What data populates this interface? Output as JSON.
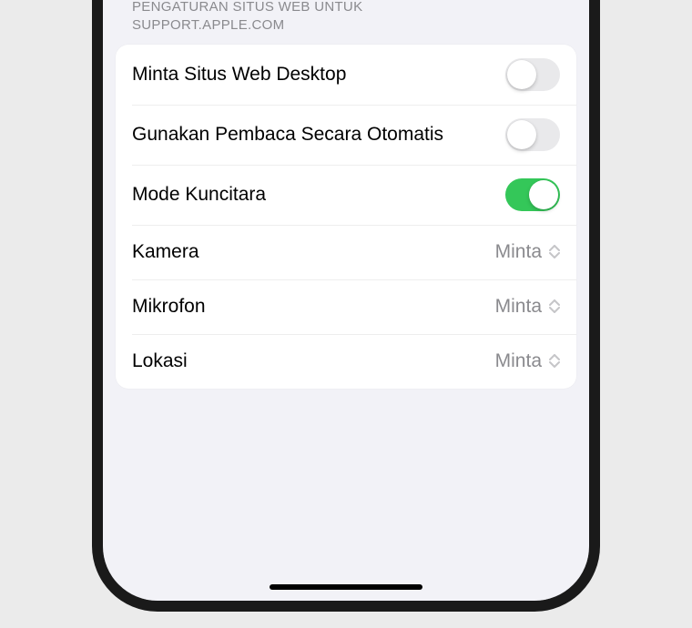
{
  "section": {
    "header_line1": "PENGATURAN SITUS WEB UNTUK",
    "header_line2": "SUPPORT.APPLE.COM"
  },
  "rows": {
    "desktop": {
      "label": "Minta Situs Web Desktop",
      "on": false
    },
    "reader": {
      "label": "Gunakan Pembaca Secara Otomatis",
      "on": false
    },
    "lockdown": {
      "label": "Mode Kuncitara",
      "on": true
    },
    "camera": {
      "label": "Kamera",
      "value": "Minta"
    },
    "microphone": {
      "label": "Mikrofon",
      "value": "Minta"
    },
    "location": {
      "label": "Lokasi",
      "value": "Minta"
    }
  }
}
